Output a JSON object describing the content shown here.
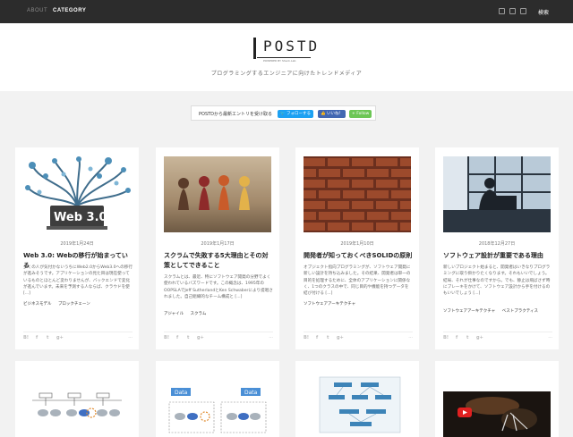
{
  "nav": {
    "about": "ABOUT",
    "category": "CATEGORY",
    "search": "検索",
    "icons": [
      "twitter-icon",
      "facebook-icon",
      "rss-icon"
    ]
  },
  "header": {
    "logo": "POSTD",
    "powered": "POWERED BY Sheck.Lab",
    "tagline": "プログラミングするエンジニアに向けたトレンドメディア"
  },
  "follow": {
    "label": "POSTDから最新エントリを受け取る",
    "twitter": "フォローする",
    "facebook": "いいね！",
    "feedly": "Follow"
  },
  "cards": [
    {
      "date": "2019年1月24日",
      "title": "Web 3.0: Webの移行が始まっている",
      "excerpt": "多くの人が気付かないうちにWeb2.0からWeb3.0への移行が進みそうです。アプリケーションの見た目は現在使っているものとほとんど変わりませんが、バックエンドで変化が進んでいます。未来を予測する人ならば、クラウドを使 [...]",
      "tags": [
        "ビジネスモデル",
        "ブロックチェーン"
      ],
      "image_text": "Web 3.0"
    },
    {
      "date": "2019年1月17日",
      "title": "スクラムで失敗する5大理由とその対策としてできること",
      "excerpt": "スクラムとは、最近、特にソフトウェア開発の分野でよく使われているバズワードです。この概念は、1995年のOOPSLAでJeff SutherlandとKen Schwaberにより提唱されました。自己組織的なチーム構成と [...]",
      "tags": [
        "アジャイル",
        "スクラム"
      ]
    },
    {
      "date": "2019年1月10日",
      "title": "開発者が知っておくべきSOLIDの原則",
      "excerpt": "オブジェクト指向プログラミングが、ソフトウェア開発に新しい設計を持ち込みました。その結果、開発者は単一の目的を処理するために、全体のアプリケーションに関係なく、1つのクラスの中で、同じ目的や機能を持つデータを結び付ける [...]",
      "tags": [
        "ソフトウェアアーキテクチャ"
      ]
    },
    {
      "date": "2018年12月27日",
      "title": "ソフトウェア設計が重要である理由",
      "excerpt": "新しいプロジェクト始まると、開発者はいきなりプログラミングに取り掛かりたくなります。それもいいでしょう。結局、それが仕事なのですから。でも、静止は飛ばさず時にブレーキをかけて、ソフトウェア設計から手を付けるのもいいでしょう [...]",
      "tags": [
        "ソフトウェアアーキテクチャ",
        "ベストプラクティス"
      ]
    }
  ],
  "share_icons": [
    "B!",
    "f",
    "t",
    "g+"
  ],
  "share_more": "...",
  "second_row": {
    "diagram_label": "Data"
  }
}
